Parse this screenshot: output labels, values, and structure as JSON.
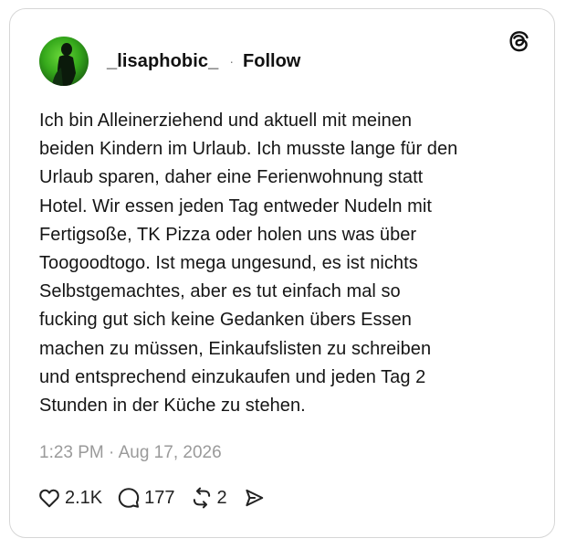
{
  "post": {
    "username": "_lisaphobic_",
    "separator": "·",
    "follow_label": "Follow",
    "lines": [
      "Ich bin Alleinerziehend und aktuell mit meinen",
      "beiden Kindern im Urlaub. Ich musste lange für den",
      "Urlaub sparen, daher eine Ferienwohnung statt",
      "Hotel. Wir essen jeden Tag entweder Nudeln mit",
      "Fertigsoße, TK Pizza oder holen uns was über",
      "Toogoodtogo. Ist mega ungesund, es ist nichts",
      "Selbstgemachtes, aber es tut einfach mal so",
      "fucking gut sich keine Gedanken übers Essen",
      "machen zu müssen, Einkaufslisten zu schreiben",
      "und entsprechend einzukaufen und jeden Tag 2",
      "Stunden in der Küche zu stehen."
    ],
    "timestamp": "1:23 PM · Aug 17, 2026"
  },
  "actions": {
    "likes": "2.1K",
    "replies": "177",
    "reposts": "2"
  },
  "icons": {
    "brand": "threads-logo-icon",
    "like": "heart-icon",
    "reply": "comment-bubble-icon",
    "repost": "repost-arrows-icon",
    "share": "send-icon"
  },
  "colors": {
    "text": "#111111",
    "muted": "#9a9a9a",
    "border": "#d6d6d6",
    "avatar_green": "#35a81b"
  }
}
